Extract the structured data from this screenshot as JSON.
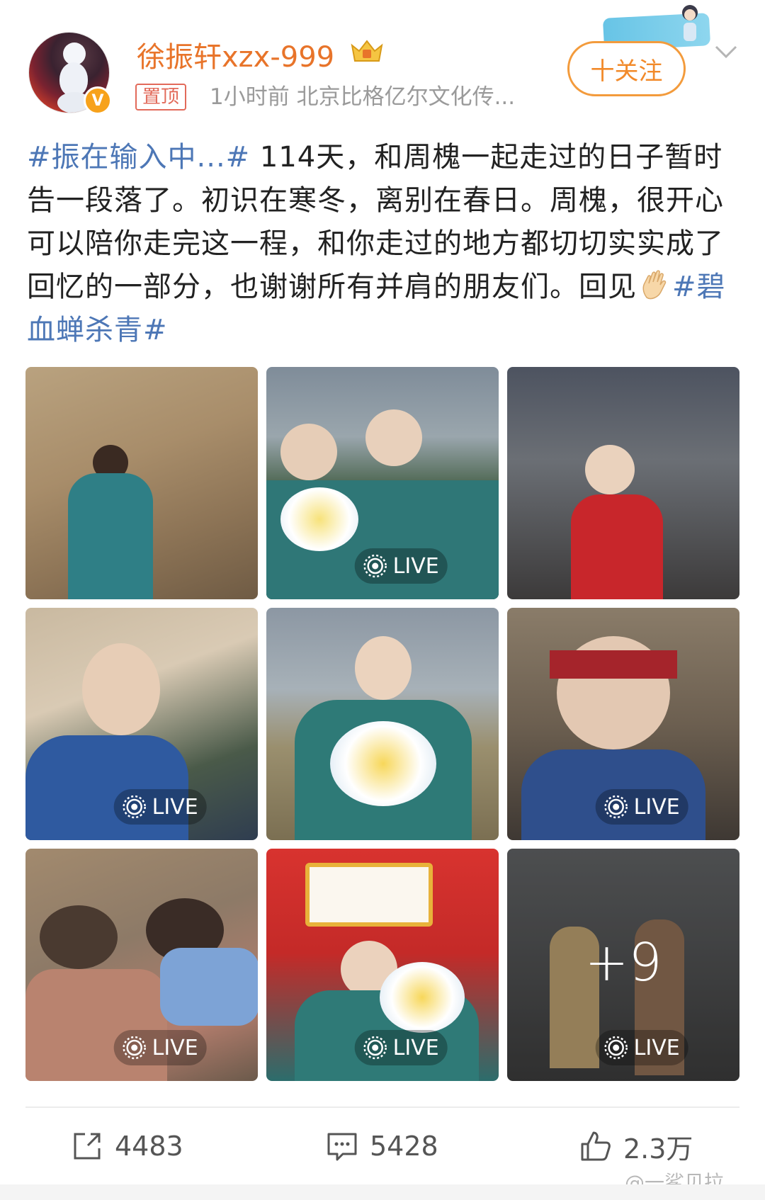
{
  "post": {
    "author": {
      "name": "徐振轩xzx-999",
      "verified_badge": "V"
    },
    "pinned_label": "置顶",
    "meta": "1小时前  北京比格亿尔文化传...",
    "follow_label": "十关注",
    "text": {
      "hashtag1": "#振在输入中...#",
      "body": " 114天，和周槐一起走过的日子暂时告一段落了。初识在寒冬，离别在春日。周槐，很开心可以陪你走完这一程，和你走过的地方都切切实实成了回忆的一部分，也谢谢所有并肩的朋友们。回见",
      "hashtag2": "#碧血蝉杀青#"
    },
    "photos": [
      {
        "live": false
      },
      {
        "live": true,
        "live_label": "LIVE"
      },
      {
        "live": false
      },
      {
        "live": true,
        "live_label": "LIVE"
      },
      {
        "live": false
      },
      {
        "live": true,
        "live_label": "LIVE"
      },
      {
        "live": true,
        "live_label": "LIVE"
      },
      {
        "live": true,
        "live_label": "LIVE"
      },
      {
        "live": true,
        "live_label": "LIVE",
        "more": "+9"
      }
    ],
    "actions": {
      "repost_count": "4483",
      "comment_count": "5428",
      "like_count": "2.3万"
    },
    "watermark": "@一鲨贝拉"
  },
  "colors": {
    "username": "#e8742a",
    "hashtag": "#4d77b6",
    "follow": "#f28a2a",
    "pinned": "#e26a5a"
  },
  "icons": [
    "verified-badge-icon",
    "crown-icon",
    "chevron-down-icon",
    "waving-hand-emoji-icon",
    "live-icon",
    "repost-icon",
    "comment-icon",
    "like-icon"
  ]
}
